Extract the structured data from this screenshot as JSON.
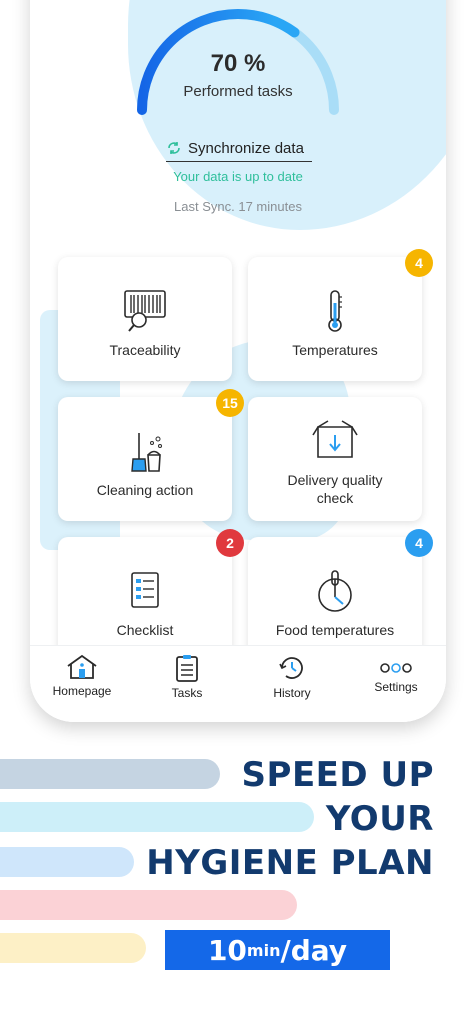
{
  "progress": {
    "value": "70 %",
    "fraction": 0.7,
    "label": "Performed tasks"
  },
  "sync": {
    "button": "Synchronize data",
    "status": "Your data is up to date",
    "last_sync": "Last Sync. 17 minutes"
  },
  "cards": [
    {
      "label": "Traceability",
      "icon": "barcode-scanner-icon"
    },
    {
      "label": "Temperatures",
      "icon": "thermometer-icon",
      "badge": "4",
      "badge_color": "#f6b500"
    },
    {
      "label": "Cleaning action",
      "icon": "broom-bucket-icon",
      "badge": "15",
      "badge_color": "#f6b500"
    },
    {
      "label": "Delivery quality check",
      "icon": "box-icon"
    },
    {
      "label": "Checklist",
      "icon": "checklist-icon",
      "badge": "2",
      "badge_color": "#e0393e"
    },
    {
      "label": "Food temperatures",
      "icon": "food-thermometer-icon",
      "badge": "4",
      "badge_color": "#2b9ef0"
    }
  ],
  "tabs": [
    {
      "label": "Homepage",
      "icon": "home-icon"
    },
    {
      "label": "Tasks",
      "icon": "clipboard-icon"
    },
    {
      "label": "History",
      "icon": "clock-icon"
    },
    {
      "label": "Settings",
      "icon": "dots-icon"
    }
  ],
  "promo": {
    "line1": "SPEED UP",
    "line2": "YOUR",
    "line3": "HYGIENE PLAN",
    "pill_num": "10",
    "pill_sup": "min",
    "pill_rest": "/day"
  },
  "colors": {
    "accent": "#1468e8",
    "navy": "#123a6e",
    "success": "#2fbf9b"
  }
}
